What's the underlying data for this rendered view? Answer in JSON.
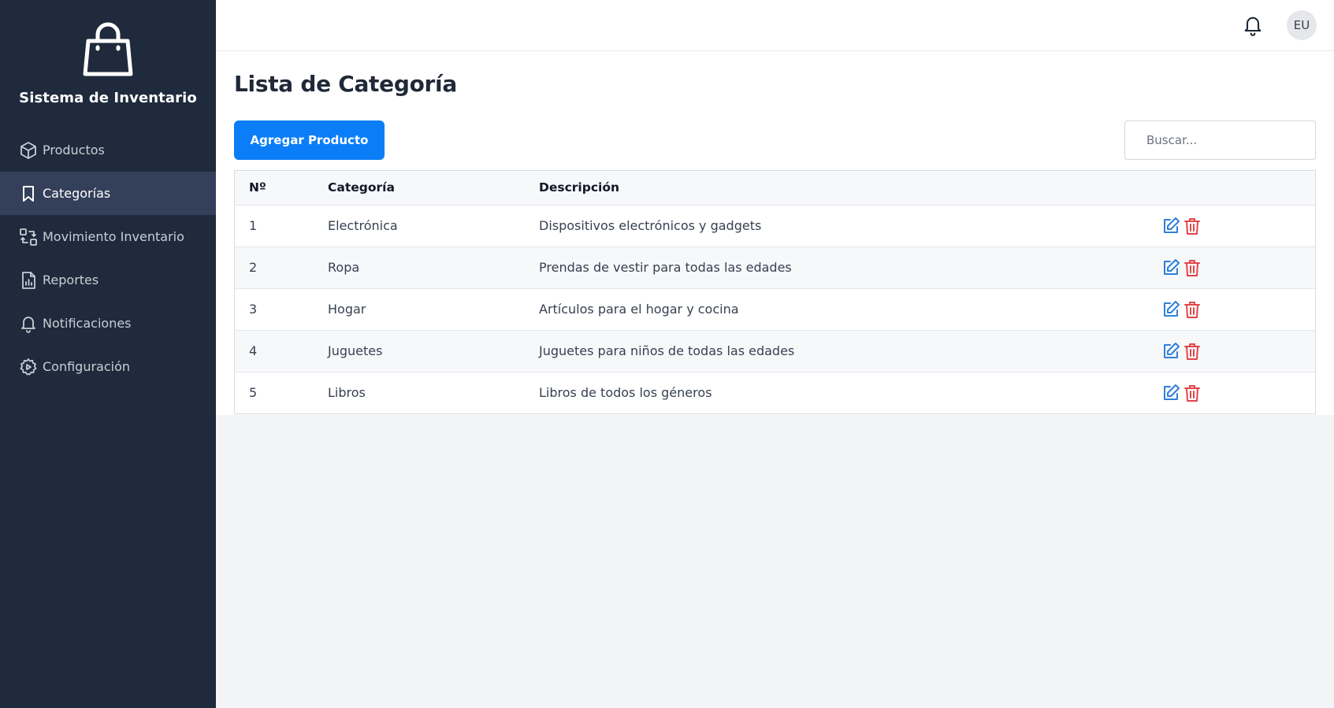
{
  "sidebar": {
    "brand_icon": "shopping-bag-icon",
    "brand_title": "Sistema de Inventario",
    "items": [
      {
        "label": "Productos",
        "icon": "box-icon",
        "active": false
      },
      {
        "label": "Categorías",
        "icon": "bookmark-icon",
        "active": true
      },
      {
        "label": "Movimiento Inventario",
        "icon": "transfer-icon",
        "active": false
      },
      {
        "label": "Reportes",
        "icon": "report-icon",
        "active": false
      },
      {
        "label": "Notificaciones",
        "icon": "bell-icon",
        "active": false
      },
      {
        "label": "Configuración",
        "icon": "gear-icon",
        "active": false
      }
    ]
  },
  "header": {
    "avatar_initials": "EU",
    "bell_icon": "bell-icon"
  },
  "main": {
    "title": "Lista de Categoría",
    "add_button_label": "Agregar Producto",
    "search_placeholder": "Buscar...",
    "table": {
      "columns": [
        "Nº",
        "Categoría",
        "Descripción",
        ""
      ],
      "rows": [
        {
          "num": "1",
          "category": "Electrónica",
          "description": "Dispositivos electrónicos y gadgets"
        },
        {
          "num": "2",
          "category": "Ropa",
          "description": "Prendas de vestir para todas las edades"
        },
        {
          "num": "3",
          "category": "Hogar",
          "description": "Artículos para el hogar y cocina"
        },
        {
          "num": "4",
          "category": "Juguetes",
          "description": "Juguetes para niños de todas las edades"
        },
        {
          "num": "5",
          "category": "Libros",
          "description": "Libros de todos los géneros"
        }
      ]
    }
  },
  "colors": {
    "sidebar_bg": "#1f2a3c",
    "sidebar_active_bg": "#34405a",
    "primary": "#0b7ef7",
    "edit_icon": "#2f80d8",
    "delete_icon": "#e0454a"
  }
}
